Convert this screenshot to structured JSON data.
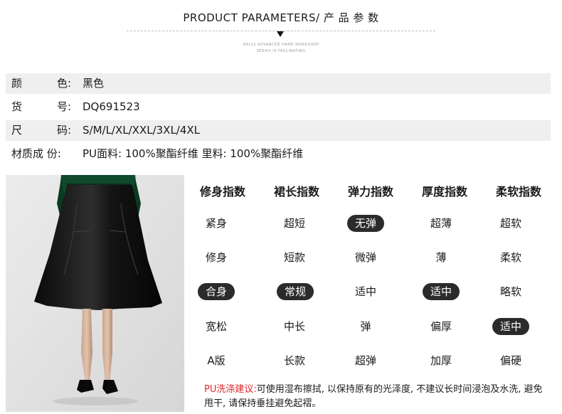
{
  "header": {
    "title": "PRODUCT PARAMETERS/ 产 品 参 数",
    "sub_line1": "DALLS ADVANCED HAND WORKSHOP",
    "sub_line2": "SERIES IS FASCINATING"
  },
  "params": {
    "color": {
      "label": "颜",
      "sep": "色:",
      "value": "黑色"
    },
    "sku": {
      "label": "货",
      "sep": "号:",
      "value": "DQ691523"
    },
    "size": {
      "label": "尺",
      "sep": "码:",
      "value": "S/M/L/XL/XXL/3XL/4XL"
    },
    "material": {
      "label": "材质成 份:",
      "value": "PU面料: 100%聚酯纤维 里料: 100%聚酯纤维"
    }
  },
  "index": {
    "headers": [
      "修身指数",
      "裙长指数",
      "弹力指数",
      "厚度指数",
      "柔软指数"
    ],
    "rows": [
      [
        "紧身",
        "超短",
        "无弹",
        "超薄",
        "超软"
      ],
      [
        "修身",
        "短款",
        "微弹",
        "薄",
        "柔软"
      ],
      [
        "合身",
        "常规",
        "适中",
        "适中",
        "略软"
      ],
      [
        "宽松",
        "中长",
        "弹",
        "偏厚",
        "适中"
      ],
      [
        "A版",
        "长款",
        "超弹",
        "加厚",
        "偏硬"
      ]
    ]
  },
  "care": {
    "label": "PU洗涤建议:",
    "text": "可使用湿布擦拭, 以保持原有的光泽度, 不建议长时间浸泡及水洗, 避免甩干, 请保持垂挂避免起褶。"
  },
  "colors": {
    "highlight": "#2b2b2b",
    "care_label": "#e0262b",
    "row_shade": "#efefef"
  }
}
